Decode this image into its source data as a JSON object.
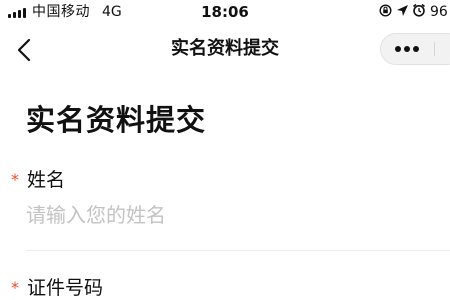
{
  "status_bar": {
    "carrier": "中国移动",
    "network": "4G",
    "time": "18:06",
    "battery": "96",
    "icons": [
      "signal-icon",
      "screen-lock-icon",
      "location-icon",
      "alarm-icon"
    ]
  },
  "nav": {
    "title": "实名资料提交",
    "back_icon": "chevron-left-icon",
    "more_icon": "more-dots-icon"
  },
  "page": {
    "title": "实名资料提交"
  },
  "form": {
    "name_field": {
      "required_mark": "*",
      "label": "姓名",
      "placeholder": "请输入您的姓名",
      "value": ""
    },
    "id_field": {
      "required_mark": "*",
      "label": "证件号码"
    }
  },
  "colors": {
    "required": "#f04a2a",
    "placeholder": "#c3c3c3",
    "text": "#111111"
  }
}
